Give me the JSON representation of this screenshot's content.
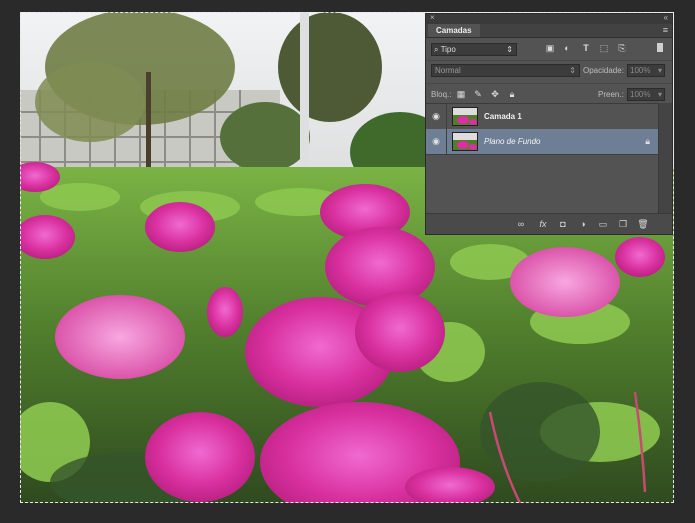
{
  "panel": {
    "close_glyph": "×",
    "collapse_glyph": "«",
    "tab_label": "Camadas",
    "menu_glyph": "≡",
    "filter": {
      "value": "Tipo"
    },
    "blend_mode": {
      "value": "Normal"
    },
    "opacity": {
      "label": "Opacidade:",
      "value": "100%"
    },
    "lock": {
      "label": "Bloq.:"
    },
    "fill": {
      "label": "Preen.:",
      "value": "100%"
    },
    "layers": [
      {
        "name": "Camada 1",
        "visible": true,
        "selected": false,
        "locked": false
      },
      {
        "name": "Plano de Fundo",
        "visible": true,
        "selected": true,
        "locked": true
      }
    ]
  },
  "icons": {
    "filter_tools": [
      "image-filter-icon",
      "adjustment-filter-icon",
      "type-filter-icon",
      "shape-filter-icon",
      "smart-object-filter-icon"
    ],
    "lock_tools": [
      "lock-transparent-pixels-icon",
      "lock-image-pixels-icon",
      "lock-position-icon",
      "lock-all-icon"
    ],
    "footer": [
      "link-layers-icon",
      "fx-icon",
      "add-mask-icon",
      "new-adjustment-icon",
      "new-group-icon",
      "new-layer-icon",
      "delete-layer-icon"
    ]
  },
  "colors": {
    "panel_bg": "#535353",
    "selection_highlight": "#6d7e95",
    "app_bg": "#2a2a2a"
  }
}
